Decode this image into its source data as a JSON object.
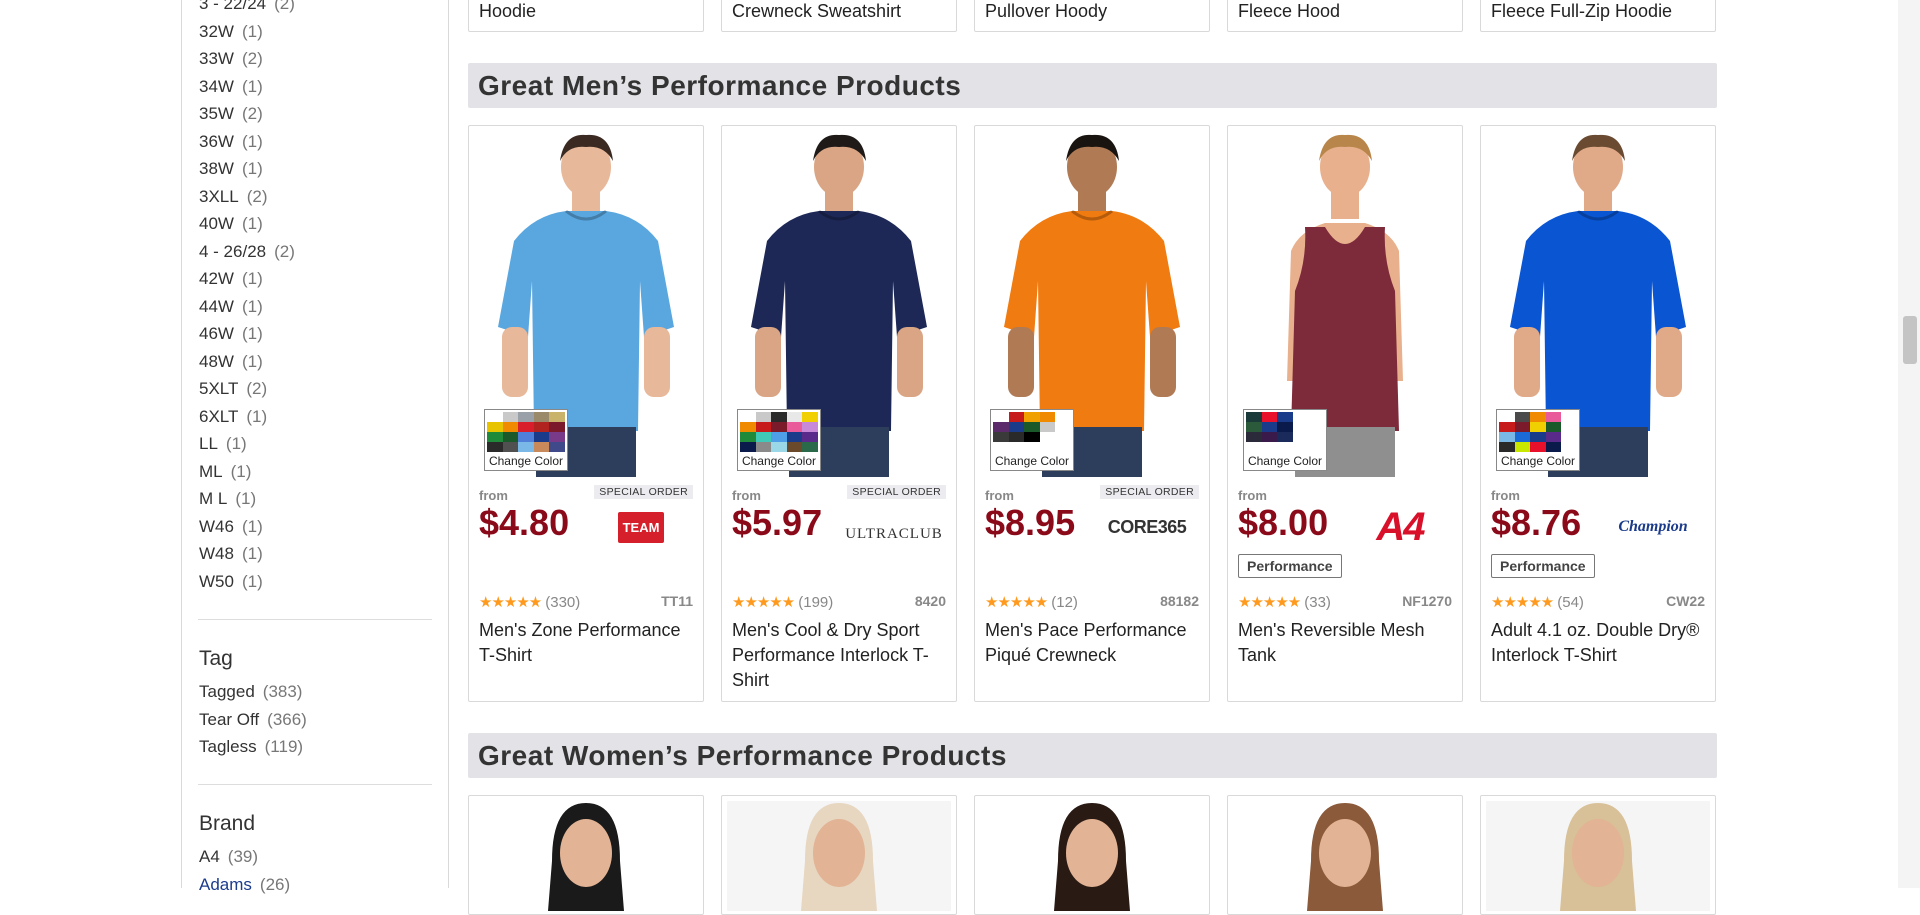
{
  "sidebar": {
    "sizes": [
      {
        "label": "3 - 22/24",
        "count": "(2)"
      },
      {
        "label": "32W",
        "count": "(1)"
      },
      {
        "label": "33W",
        "count": "(2)"
      },
      {
        "label": "34W",
        "count": "(1)"
      },
      {
        "label": "35W",
        "count": "(2)"
      },
      {
        "label": "36W",
        "count": "(1)"
      },
      {
        "label": "38W",
        "count": "(1)"
      },
      {
        "label": "3XLL",
        "count": "(2)"
      },
      {
        "label": "40W",
        "count": "(1)"
      },
      {
        "label": "4 - 26/28",
        "count": "(2)"
      },
      {
        "label": "42W",
        "count": "(1)"
      },
      {
        "label": "44W",
        "count": "(1)"
      },
      {
        "label": "46W",
        "count": "(1)"
      },
      {
        "label": "48W",
        "count": "(1)"
      },
      {
        "label": "5XLT",
        "count": "(2)"
      },
      {
        "label": "6XLT",
        "count": "(1)"
      },
      {
        "label": "LL",
        "count": "(1)"
      },
      {
        "label": "ML",
        "count": "(1)"
      },
      {
        "label": "M L",
        "count": "(1)"
      },
      {
        "label": "W46",
        "count": "(1)"
      },
      {
        "label": "W48",
        "count": "(1)"
      },
      {
        "label": "W50",
        "count": "(1)"
      }
    ],
    "tag": {
      "title": "Tag",
      "items": [
        {
          "label": "Tagged",
          "count": "(383)"
        },
        {
          "label": "Tear Off",
          "count": "(366)"
        },
        {
          "label": "Tagless",
          "count": "(119)"
        }
      ]
    },
    "brand": {
      "title": "Brand",
      "items": [
        {
          "label": "A4",
          "count": "(39)"
        },
        {
          "label": "Adams",
          "count": "(26)"
        }
      ]
    }
  },
  "top_row": [
    "Hoodie",
    "Crewneck Sweatshirt",
    "Pullover Hoody",
    "Fleece Hood",
    "Fleece Full-Zip Hoodie"
  ],
  "men_section": {
    "title": "Great Men’s Performance Products",
    "products": [
      {
        "from": "from",
        "price": "$4.80",
        "special": "SPECIAL ORDER",
        "brand": "TEAM 365",
        "brand_text": "TEAM",
        "tag": "",
        "rating_count": "(330)",
        "sku": "TT11",
        "name": "Men's Zone Performance T-Shirt",
        "shirt_color": "#5aa7e0",
        "change_color": "Change Color",
        "swatches": [
          "#ffffff",
          "#c9c9c9",
          "#9aa0a8",
          "#9a8a6a",
          "#c9b26a",
          "#e8c400",
          "#f08a00",
          "#d81e2a",
          "#b0231e",
          "#7a1a2a",
          "#1f8a3a",
          "#1a5a2a",
          "#4f7fd8",
          "#1a3a8a",
          "#7a3a8a",
          "#2a2a2a",
          "#505050",
          "#7ab8e8",
          "#c88a5a",
          "#404a8a"
        ]
      },
      {
        "from": "from",
        "price": "$5.97",
        "special": "SPECIAL ORDER",
        "brand": "UltraClub",
        "brand_text": "ULTRACLUB",
        "tag": "",
        "rating_count": "(199)",
        "sku": "8420",
        "name": "Men's Cool & Dry Sport Performance Interlock T-Shirt",
        "shirt_color": "#1d2856",
        "change_color": "Change Color",
        "swatches": [
          "#ffffff",
          "#c9c9c9",
          "#2a2a2a",
          "#e8e8e8",
          "#f0d000",
          "#f08a00",
          "#c71a1a",
          "#7a1a2a",
          "#e85a9a",
          "#c88ad8",
          "#1f8a3a",
          "#40c8b8",
          "#4f9fe8",
          "#1a3a8a",
          "#5a2a8a",
          "#0a1a4a",
          "#8a8a8a",
          "#9ad8e8",
          "#6a4a2a",
          "#2a6a4a"
        ]
      },
      {
        "from": "from",
        "price": "$8.95",
        "special": "SPECIAL ORDER",
        "brand": "Core 365",
        "brand_text": "CORE365",
        "tag": "",
        "rating_count": "(12)",
        "sku": "88182",
        "name": "Men's Pace Performance Piqué Crewneck",
        "shirt_color": "#f07b10",
        "change_color": "Change Color",
        "swatches": [
          "#ffffff",
          "#c71a1a",
          "#f0a000",
          "#f08a00",
          "#ffffff",
          "#5a2a6a",
          "#1a3a8a",
          "#1a5a2a",
          "#c9c9c9",
          "#ffffff",
          "#3a3a3a",
          "#2a2a2a",
          "#000000",
          "#ffffff",
          "#ffffff",
          "#ffffff",
          "#ffffff",
          "#ffffff",
          "#ffffff",
          "#ffffff"
        ]
      },
      {
        "from": "from",
        "price": "$8.00",
        "special": "",
        "brand": "A4",
        "brand_text": "A4",
        "tag": "Performance",
        "rating_count": "(33)",
        "sku": "NF1270",
        "name": "Men's Reversible Mesh Tank",
        "shirt_color": "#7d2a3a",
        "change_color": "Change Color",
        "swatches": [
          "#1a3a3a",
          "#e8102a",
          "#1a3a8a",
          "#ffffff",
          "#ffffff",
          "#2a5a3a",
          "#1a3a8a",
          "#0a1a4a",
          "#ffffff",
          "#ffffff",
          "#2a2a3a",
          "#3a1a4a",
          "#1a2a5a",
          "#ffffff",
          "#ffffff",
          "#ffffff",
          "#ffffff",
          "#ffffff",
          "#ffffff",
          "#ffffff"
        ]
      },
      {
        "from": "from",
        "price": "$8.76",
        "special": "",
        "brand": "Champion",
        "brand_text": "Champion",
        "tag": "Performance",
        "rating_count": "(54)",
        "sku": "CW22",
        "name": "Adult 4.1 oz. Double Dry® Interlock T-Shirt",
        "shirt_color": "#0a55d2",
        "change_color": "Change Color",
        "swatches": [
          "#ffffff",
          "#4a4a4a",
          "#f08a00",
          "#e85a9a",
          "#ffffff",
          "#c71a1a",
          "#7a1a2a",
          "#f0d000",
          "#1a5a2a",
          "#ffffff",
          "#7ab8e8",
          "#1a6ad8",
          "#1a3a8a",
          "#5a2a8a",
          "#ffffff",
          "#2a2a2a",
          "#c8e800",
          "#e8102a",
          "#0a1a4a",
          "#ffffff"
        ]
      }
    ]
  },
  "women_section": {
    "title": "Great Women’s Performance Products"
  },
  "colors": {
    "price": "#8a0a1a",
    "header_bg": "#e3e3e7",
    "star": "#ff9a1e"
  }
}
